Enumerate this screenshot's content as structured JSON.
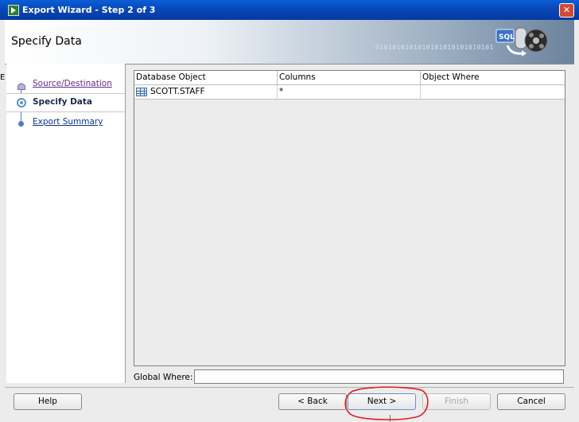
{
  "window": {
    "title": "Export Wizard - Step 2 of 3",
    "close_symbol": "✕",
    "edge_char": "E"
  },
  "header": {
    "page_title": "Specify Data",
    "binary_text": "0101010101010101010101010101",
    "graphic_label": "SQL"
  },
  "nav": {
    "items": [
      {
        "label": "Source/Destination",
        "state": "visited"
      },
      {
        "label": "Specify Data",
        "state": "current"
      },
      {
        "label": "Export Summary",
        "state": "link"
      }
    ]
  },
  "table": {
    "columns": [
      "Database Object",
      "Columns",
      "Object Where"
    ],
    "rows": [
      {
        "object": "SCOTT.STAFF",
        "columns": "*",
        "where": ""
      }
    ]
  },
  "global_where": {
    "label": "Global Where:",
    "value": ""
  },
  "buttons": {
    "help": "Help",
    "back": "< Back",
    "next": "Next >",
    "finish": "Finish",
    "cancel": "Cancel"
  },
  "colors": {
    "title_bar": "#0847b8",
    "annotation": "#e02020",
    "link": "#1030a0"
  },
  "icons": [
    "app-icon",
    "close-icon",
    "sql-graphic-icon",
    "table-icon",
    "step-node-icon"
  ]
}
